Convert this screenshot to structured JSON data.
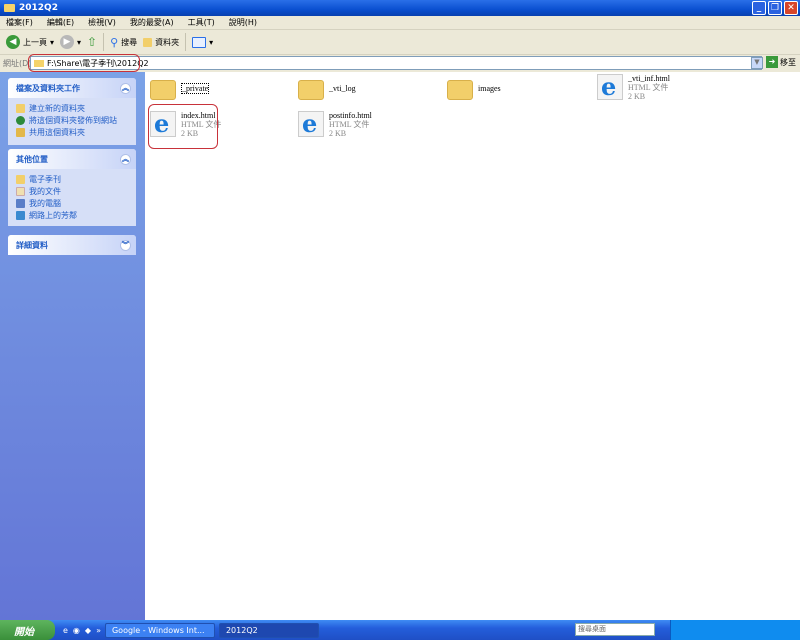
{
  "window": {
    "title": "2012Q2",
    "controls": [
      "_",
      "❐",
      "✕"
    ]
  },
  "menu": [
    "檔案(F)",
    "編輯(E)",
    "檢視(V)",
    "我的最愛(A)",
    "工具(T)",
    "說明(H)"
  ],
  "toolbar": {
    "back": "上一頁",
    "search": "搜尋",
    "folders": "資料夾"
  },
  "address": {
    "label": "網址(D)",
    "value": "F:\\Share\\電子季刊\\2012Q2",
    "go": "移至"
  },
  "sidebar": {
    "tasks": {
      "title": "檔案及資料夾工作",
      "items": [
        "建立新的資料夾",
        "將這個資料夾發佈到網站",
        "共用這個資料夾"
      ]
    },
    "places": {
      "title": "其他位置",
      "items": [
        "電子季刊",
        "我的文件",
        "我的電腦",
        "網路上的芳鄰"
      ]
    },
    "details": {
      "title": "詳細資料"
    }
  },
  "files": [
    {
      "name": "_private",
      "type": "folder"
    },
    {
      "name": "_vti_log",
      "type": "folder"
    },
    {
      "name": "images",
      "type": "folder"
    },
    {
      "name": "_vti_inf.html",
      "type": "html",
      "kind": "HTML 文件",
      "size": "2 KB"
    },
    {
      "name": "index.html",
      "type": "html",
      "kind": "HTML 文件",
      "size": "2 KB"
    },
    {
      "name": "postinfo.html",
      "type": "html",
      "kind": "HTML 文件",
      "size": "2 KB"
    }
  ],
  "taskbar": {
    "start": "開始",
    "tasks": [
      "Google - Windows Int...",
      "2012Q2"
    ],
    "search_placeholder": "搜尋桌面"
  },
  "colors": {
    "titlebar": "#0a4fd0",
    "sidebar": "#7ba2e7",
    "highlight": "#c8323a"
  }
}
